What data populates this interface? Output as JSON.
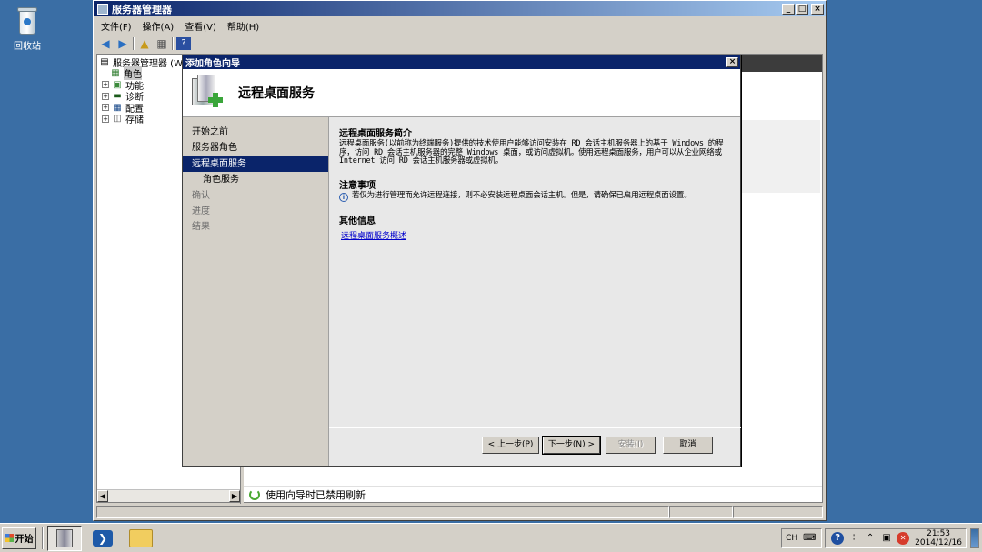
{
  "desktop": {
    "recycle_bin_label": "回收站"
  },
  "server_manager": {
    "title": "服务器管理器",
    "menu": [
      "文件(F)",
      "操作(A)",
      "查看(V)",
      "帮助(H)"
    ],
    "tree": [
      {
        "label": "服务器管理器 (W",
        "icon": "server-manager-icon"
      },
      {
        "label": "角色",
        "icon": "roles-icon"
      },
      {
        "label": "功能",
        "icon": "features-icon"
      },
      {
        "label": "诊断",
        "icon": "diagnostics-icon"
      },
      {
        "label": "配置",
        "icon": "configuration-icon"
      },
      {
        "label": "存储",
        "icon": "storage-icon"
      }
    ],
    "status_message": "使用向导时已禁用刷新"
  },
  "wizard": {
    "title": "添加角色向导",
    "header_title": "远程桌面服务",
    "nav": [
      {
        "label": "开始之前",
        "state": "normal"
      },
      {
        "label": "服务器角色",
        "state": "normal"
      },
      {
        "label": "远程桌面服务",
        "state": "active"
      },
      {
        "label": "角色服务",
        "state": "sub"
      },
      {
        "label": "确认",
        "state": "dim"
      },
      {
        "label": "进度",
        "state": "dim"
      },
      {
        "label": "结果",
        "state": "dim"
      }
    ],
    "content": {
      "intro_heading": "远程桌面服务简介",
      "intro_text": "远程桌面服务(以前称为终端服务)提供的技术使用户能够访问安装在 RD 会话主机服务器上的基于 Windows 的程序，访问 RD 会话主机服务器的完整 Windows 桌面，或访问虚拟机。使用远程桌面服务，用户可以从企业网络或 Internet 访问 RD 会话主机服务器或虚拟机。",
      "notes_heading": "注意事项",
      "notes_text": "若仅为进行管理而允许远程连接，则不必安装远程桌面会话主机。但是，请确保已启用远程桌面设置。",
      "more_heading": "其他信息",
      "link_text": "远程桌面服务概述"
    },
    "buttons": {
      "back": "< 上一步(P)",
      "next": "下一步(N) >",
      "install": "安装(I)",
      "cancel": "取消"
    }
  },
  "taskbar": {
    "start_label": "开始",
    "input_lang": "CH",
    "time": "21:53",
    "date": "2014/12/16"
  }
}
